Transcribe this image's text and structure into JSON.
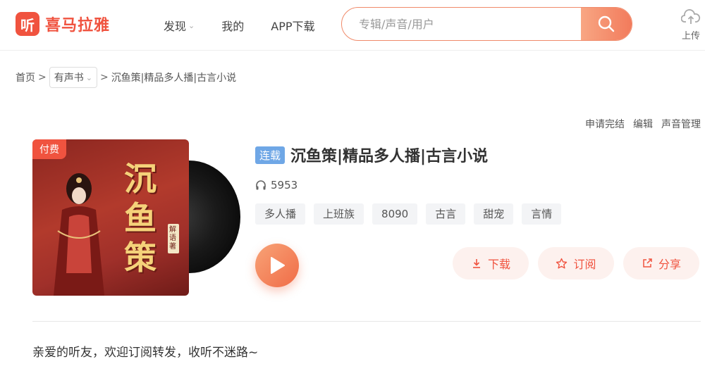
{
  "brand": {
    "logo_char": "听",
    "name": "喜马拉雅",
    "accent": "#f0533f"
  },
  "nav": {
    "items": [
      {
        "label": "发现",
        "has_dropdown": true
      },
      {
        "label": "我的"
      },
      {
        "label": "APP下载"
      }
    ]
  },
  "search": {
    "placeholder": "专辑/声音/用户",
    "value": ""
  },
  "upload": {
    "label": "上传"
  },
  "breadcrumb": {
    "home": "首页",
    "sep1": ">",
    "category": "有声书",
    "sep2": ">",
    "current": "沉鱼策|精品多人播|古言小说"
  },
  "admin_links": {
    "finish": "申请完结",
    "edit": "编辑",
    "manage": "声音管理"
  },
  "cover": {
    "badge": "付费",
    "title_chars": [
      "沉",
      "鱼",
      "策"
    ],
    "author": "解语著"
  },
  "album": {
    "status_tag": "连载",
    "title": "沉鱼策|精品多人播|古言小说",
    "play_count": "5953",
    "tags": [
      "多人播",
      "上班族",
      "8090",
      "古言",
      "甜宠",
      "言情"
    ]
  },
  "actions": {
    "download": "下载",
    "subscribe": "订阅",
    "share": "分享"
  },
  "intro": {
    "line1": "亲爱的听友，欢迎订阅转发，收听不迷路~"
  }
}
